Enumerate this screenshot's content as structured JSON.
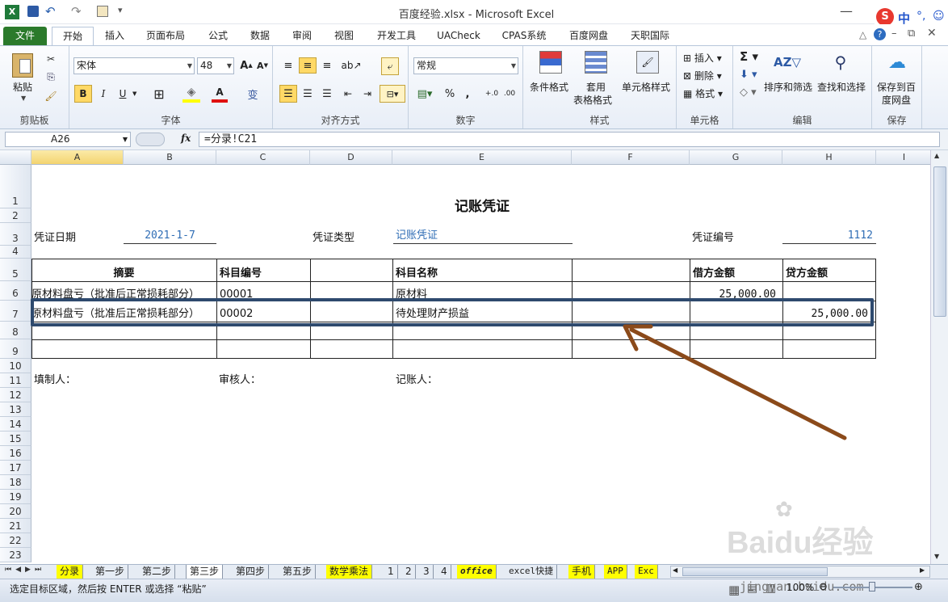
{
  "window": {
    "title": "百度经验.xlsx  -  Microsoft Excel",
    "ime": "中"
  },
  "tabs": [
    {
      "label": "文件",
      "active": false,
      "file": true
    },
    {
      "label": "开始",
      "active": true
    },
    {
      "label": "插入"
    },
    {
      "label": "页面布局"
    },
    {
      "label": "公式"
    },
    {
      "label": "数据"
    },
    {
      "label": "审阅"
    },
    {
      "label": "视图"
    },
    {
      "label": "开发工具"
    },
    {
      "label": "UACheck"
    },
    {
      "label": "CPAS系统"
    },
    {
      "label": "百度网盘"
    },
    {
      "label": "天职国际"
    }
  ],
  "ribbon": {
    "clipboard": {
      "paste": "粘贴",
      "label": "剪贴板"
    },
    "font": {
      "name": "宋体",
      "size": "48",
      "bold": "B",
      "italic": "I",
      "underline": "U",
      "label": "字体"
    },
    "align": {
      "label": "对齐方式"
    },
    "number": {
      "format": "常规",
      "label": "数字"
    },
    "styles": {
      "cond": "条件格式",
      "table1": "套用",
      "table2": "表格格式",
      "cell": "单元格样式",
      "label": "样式"
    },
    "cells": {
      "insert": "插入",
      "delete": "删除",
      "format": "格式",
      "label": "单元格"
    },
    "editing": {
      "sort": "排序和筛选",
      "find": "查找和选择",
      "label": "编辑"
    },
    "save": {
      "line1": "保存到百",
      "line2": "度网盘",
      "label": "保存"
    }
  },
  "formula_bar": {
    "name_box": "A26",
    "fx": "fx",
    "formula": "=分录!C21"
  },
  "columns": [
    "A",
    "B",
    "C",
    "D",
    "E",
    "F",
    "G",
    "H",
    "I"
  ],
  "rows": [
    "1",
    "2",
    "3",
    "4",
    "5",
    "6",
    "7",
    "8",
    "9",
    "10",
    "11",
    "12",
    "13",
    "14",
    "15",
    "16",
    "17",
    "18",
    "19",
    "20",
    "21",
    "22",
    "23"
  ],
  "sheet": {
    "title": "记账凭证",
    "date_label": "凭证日期",
    "date_value": "2021-1-7",
    "type_label": "凭证类型",
    "type_value": "记账凭证",
    "no_label": "凭证编号",
    "no_value": "1112",
    "headers": {
      "summary": "摘要",
      "code": "科目编号",
      "name": "科目名称",
      "debit": "借方金额",
      "credit": "贷方金额"
    },
    "row6": {
      "summary": "原材料盘亏（批准后正常损耗部分）",
      "code": "00001",
      "name": "原材料",
      "debit": "25,000.00",
      "credit": ""
    },
    "row7": {
      "summary": "原材料盘亏（批准后正常损耗部分）",
      "code": "00002",
      "name": "待处理财产损益",
      "debit": "",
      "credit": "25,000.00"
    },
    "maker": "填制人：",
    "checker": "审核人：",
    "bookkeeper": "记账人："
  },
  "sheet_tabs": [
    {
      "label": "分录",
      "color": "#ffff00"
    },
    {
      "label": "第一步",
      "color": ""
    },
    {
      "label": "第二步",
      "color": ""
    },
    {
      "label": "第三步",
      "color": "#ffffff",
      "active": true
    },
    {
      "label": "第四步",
      "color": ""
    },
    {
      "label": "第五步",
      "color": ""
    },
    {
      "label": "数学乘法",
      "color": "#ffff00"
    },
    {
      "label": "1",
      "color": ""
    },
    {
      "label": "2",
      "color": ""
    },
    {
      "label": "3",
      "color": ""
    },
    {
      "label": "4",
      "color": ""
    },
    {
      "label": "office",
      "color": "#ffff00"
    },
    {
      "label": "excel快捷",
      "color": ""
    },
    {
      "label": "手机",
      "color": "#ffff00"
    },
    {
      "label": "APP",
      "color": "#ffff00"
    },
    {
      "label": "Exc",
      "color": "#ffff00"
    }
  ],
  "status": {
    "message": "选定目标区域，然后按 ENTER 或选择 “粘贴”",
    "zoom": "100%"
  },
  "watermark": {
    "text": "Baidu经验",
    "url": "jingyan.baidu.com"
  },
  "colors": {
    "accent_blue": "#2f6db5",
    "file_green": "#2b7a2b",
    "highlight_box": "#2e4a6e",
    "arrow": "#8b4a1a"
  }
}
